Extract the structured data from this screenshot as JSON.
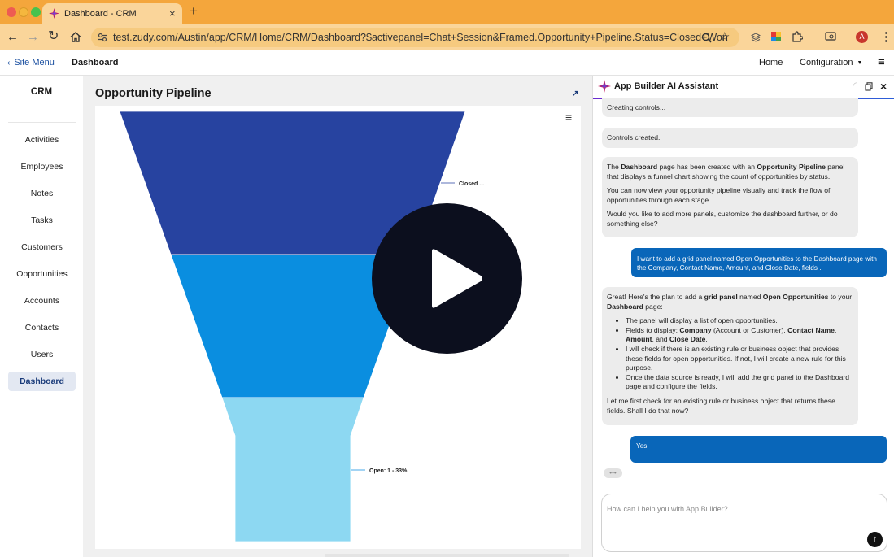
{
  "browser": {
    "tab_title": "Dashboard - CRM",
    "url": "test.zudy.com/Austin/app/CRM/Home/CRM/Dashboard?$activepanel=Chat+Session&Framed.Opportunity+Pipeline.Status=Closed+Won",
    "profile_initial": "A"
  },
  "header": {
    "site_menu": "Site Menu",
    "page": "Dashboard",
    "home": "Home",
    "configuration": "Configuration"
  },
  "sidebar": {
    "app_name": "CRM",
    "items": [
      "Activities",
      "Employees",
      "Notes",
      "Tasks",
      "Customers",
      "Opportunities",
      "Accounts",
      "Contacts",
      "Users",
      "Dashboard"
    ],
    "active": "Dashboard"
  },
  "panel": {
    "title": "Opportunity Pipeline"
  },
  "chart_data": {
    "type": "funnel",
    "labels": [
      "Closed ...",
      "Open: 1 - 33%"
    ],
    "colors": [
      "#2743a0",
      "#0a8ee0",
      "#8dd8f2"
    ]
  },
  "chat": {
    "title": "App Builder AI Assistant",
    "messages": {
      "m1": "Creating controls...",
      "m2": "Controls created.",
      "m3": {
        "p1a": "The ",
        "p1b": "Dashboard",
        "p1c": " page has been created with an ",
        "p1d": "Opportunity Pipeline",
        "p1e": " panel that displays a funnel chart showing the count of opportunities by status.",
        "p2": "You can now view your opportunity pipeline visually and track the flow of opportunities through each stage.",
        "p3": "Would you like to add more panels, customize the dashboard further, or do something else?"
      },
      "u1": "I want to add a grid panel named Open Opportunities to the Dashboard page with the Company, Contact Name, Amount, and Close Date, fields .",
      "m4": {
        "intro_a": "Great! Here's the plan to add a ",
        "intro_b": "grid panel",
        "intro_c": " named ",
        "intro_d": "Open Opportunities",
        "intro_e": " to your ",
        "intro_f": "Dashboard",
        "intro_g": " page:",
        "b1": "The panel will display a list of open opportunities.",
        "b2a": "Fields to display: ",
        "b2b": "Company",
        "b2c": " (Account or Customer), ",
        "b2d": "Contact Name",
        "b2e": ", ",
        "b2f": "Amount",
        "b2g": ", and ",
        "b2h": "Close Date",
        "b2i": ".",
        "b3": "I will check if there is an existing rule or business object that provides these fields for open opportunities. If not, I will create a new rule for this purpose.",
        "b4": "Once the data source is ready, I will add the grid panel to the Dashboard page and configure the fields.",
        "outro": "Let me first check for an existing rule or business object that returns these fields. Shall I do that now?"
      },
      "u2": "Yes"
    },
    "input_placeholder": "How can I help you with App Builder?"
  },
  "colors": {
    "accent": "#0966b9",
    "browser_chrome": "#f4a63c",
    "active_nav_bg": "#e3e8f2"
  }
}
